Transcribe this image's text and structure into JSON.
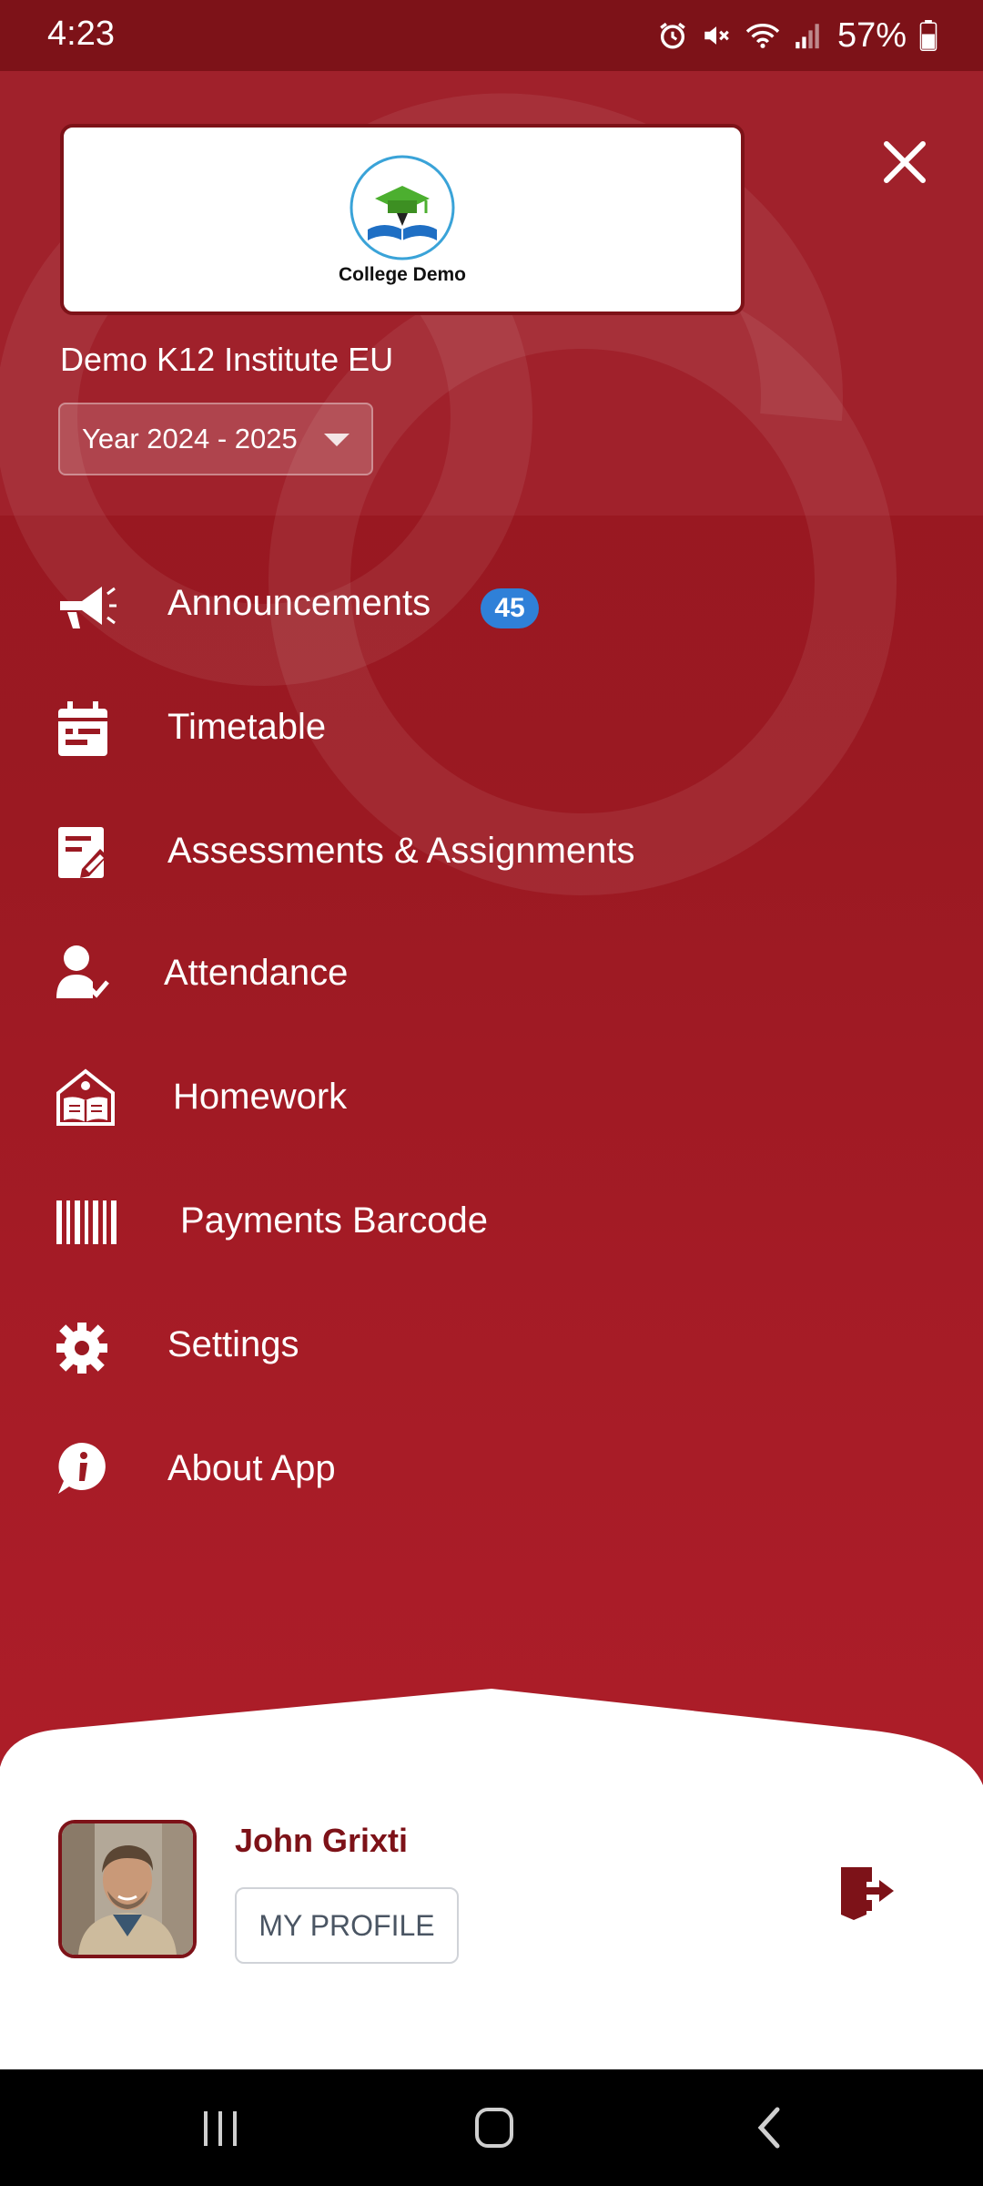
{
  "status_bar": {
    "time": "4:23",
    "battery": "57%",
    "icons": [
      "alarm-icon",
      "mute-icon",
      "wifi-icon",
      "signal-icon",
      "battery-icon"
    ]
  },
  "header": {
    "logo_text": "College Demo",
    "institute_name": "Demo K12 Institute EU",
    "year_selector": "Year 2024 - 2025"
  },
  "menu": {
    "items": [
      {
        "label": "Announcements",
        "icon": "megaphone-icon",
        "badge": "45"
      },
      {
        "label": "Timetable",
        "icon": "calendar-icon"
      },
      {
        "label": "Assessments & Assignments",
        "icon": "edit-document-icon"
      },
      {
        "label": "Attendance",
        "icon": "user-check-icon"
      },
      {
        "label": "Homework",
        "icon": "school-book-icon"
      },
      {
        "label": "Payments Barcode",
        "icon": "barcode-icon"
      },
      {
        "label": "Settings",
        "icon": "gear-icon"
      },
      {
        "label": "About App",
        "icon": "info-chat-icon"
      }
    ]
  },
  "profile": {
    "name": "John Grixti",
    "button_label": "MY PROFILE"
  },
  "colors": {
    "primary": "#9b1922",
    "dark": "#7d1218",
    "badge": "#2f80d8"
  }
}
